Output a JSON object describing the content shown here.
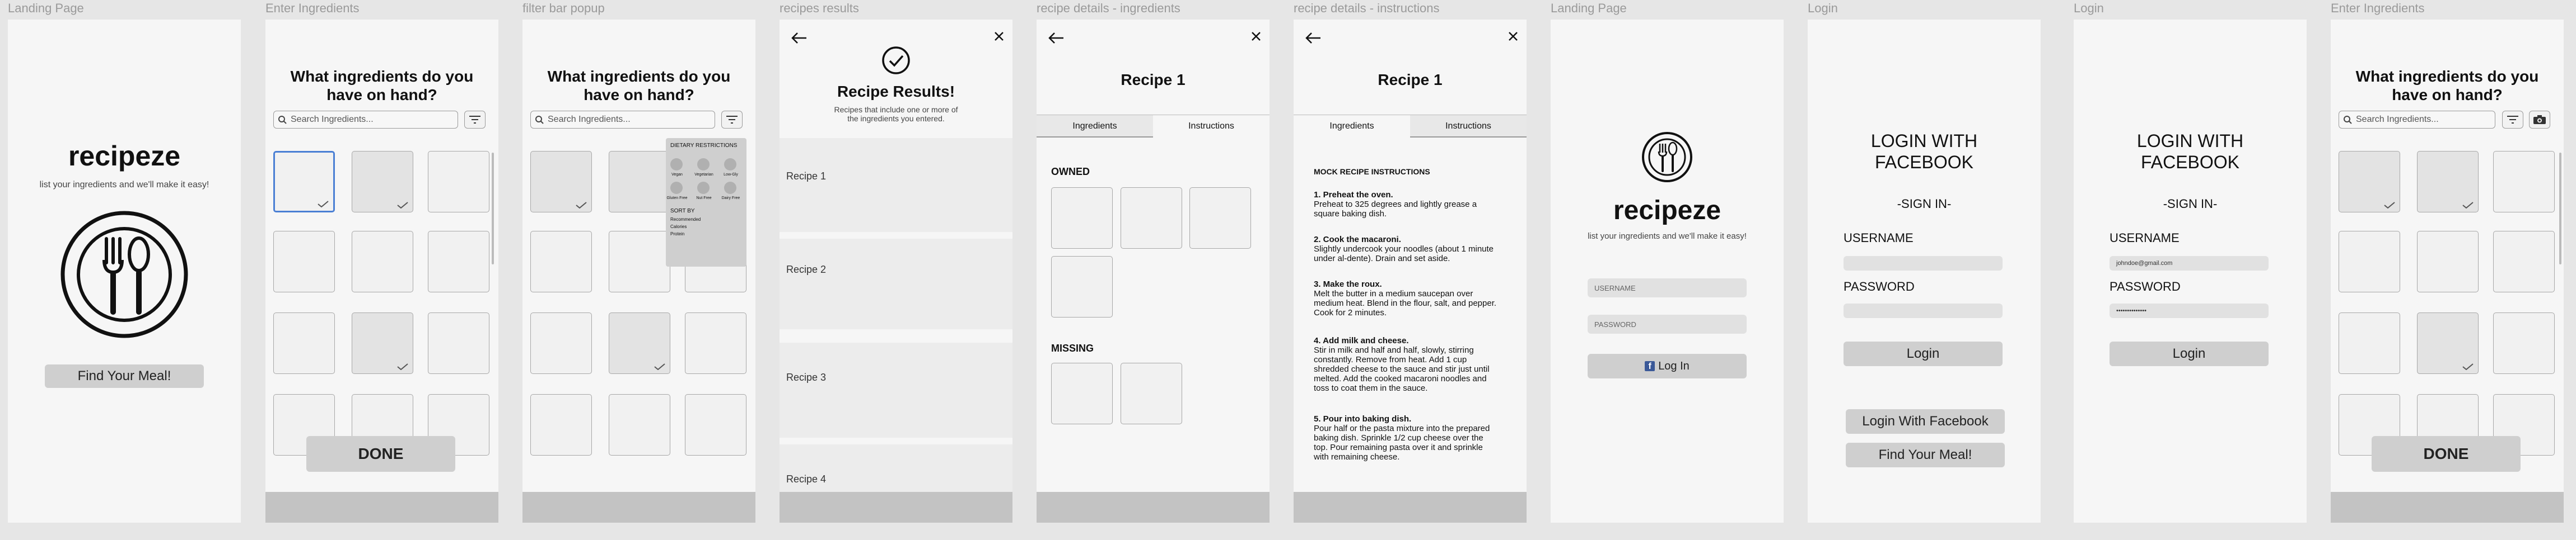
{
  "frames": [
    {
      "label": "Landing Page"
    },
    {
      "label": "Enter Ingredients"
    },
    {
      "label": "filter bar popup"
    },
    {
      "label": "recipes results"
    },
    {
      "label": "recipe details - ingredients"
    },
    {
      "label": "recipe details - instructions"
    },
    {
      "label": "Landing Page"
    },
    {
      "label": "Login"
    },
    {
      "label": "Login"
    },
    {
      "label": "Enter Ingredients"
    }
  ],
  "landing": {
    "logo": "recipeze",
    "tagline": "list your ingredients and we'll make it easy!",
    "find_meal": "Find Your Meal!",
    "icon": "fork-spoon-icon"
  },
  "ingredients": {
    "title": "What ingredients do you have on hand?",
    "search_placeholder": "Search Ingredients...",
    "done": "DONE"
  },
  "filter": {
    "dietary_title": "DIETARY RESTRICTIONS",
    "options": [
      "Vegan",
      "Vegetarian",
      "Low-Gly",
      "Gluten Free",
      "Nut Free",
      "Dairy Free"
    ],
    "sort_title": "SORT BY",
    "sort_options": [
      "Recommended",
      "Calories",
      "Protein"
    ]
  },
  "results": {
    "title": "Recipe Results!",
    "subtitle": "Recipes that include one or more of the ingredients you entered.",
    "recipes": [
      "Recipe 1",
      "Recipe 2",
      "Recipe 3",
      "Recipe 4"
    ]
  },
  "details": {
    "title": "Recipe 1",
    "tab_ingredients": "Ingredients",
    "tab_instructions": "Instructions",
    "owned": "OWNED",
    "missing": "MISSING",
    "instructions_heading": "MOCK RECIPE INSTRUCTIONS",
    "steps": [
      {
        "title": "1. Preheat the oven.",
        "text": "Preheat to 325 degrees and lightly grease a square baking dish."
      },
      {
        "title": "2. Cook the macaroni.",
        "text": "Slightly undercook your noodles (about 1 minute under al-dente). Drain and set aside."
      },
      {
        "title": "3. Make the roux.",
        "text": "Melt the butter in a medium saucepan over medium heat. Blend in the flour, salt, and pepper. Cook for 2 minutes."
      },
      {
        "title": "4. Add milk and cheese.",
        "text": "Stir in milk and half and half, slowly, stirring constantly. Remove from heat. Add 1 cup shredded cheese to the sauce and stir just until melted. Add the cooked macaroni noodles and toss to coat them in the sauce."
      },
      {
        "title": "5. Pour into baking dish.",
        "text": "Pour half or the pasta mixture into the prepared baking dish. Sprinkle 1/2 cup cheese over the top. Pour remaining pasta over it and sprinkle with remaining cheese."
      }
    ]
  },
  "landing2": {
    "logo": "recipeze",
    "tagline": "list your ingredients and we'll make it easy!",
    "username": "USERNAME",
    "password": "PASSWORD",
    "login": "Log In"
  },
  "login": {
    "title": "LOGIN WITH FACEBOOK",
    "signin": "-SIGN IN-",
    "username_label": "USERNAME",
    "password_label": "PASSWORD",
    "login_btn": "Login",
    "fb_btn": "Login With Facebook",
    "find_meal": "Find Your Meal!",
    "email_value": "johndoe@gmail.com",
    "password_value": "••••••••••••••"
  }
}
